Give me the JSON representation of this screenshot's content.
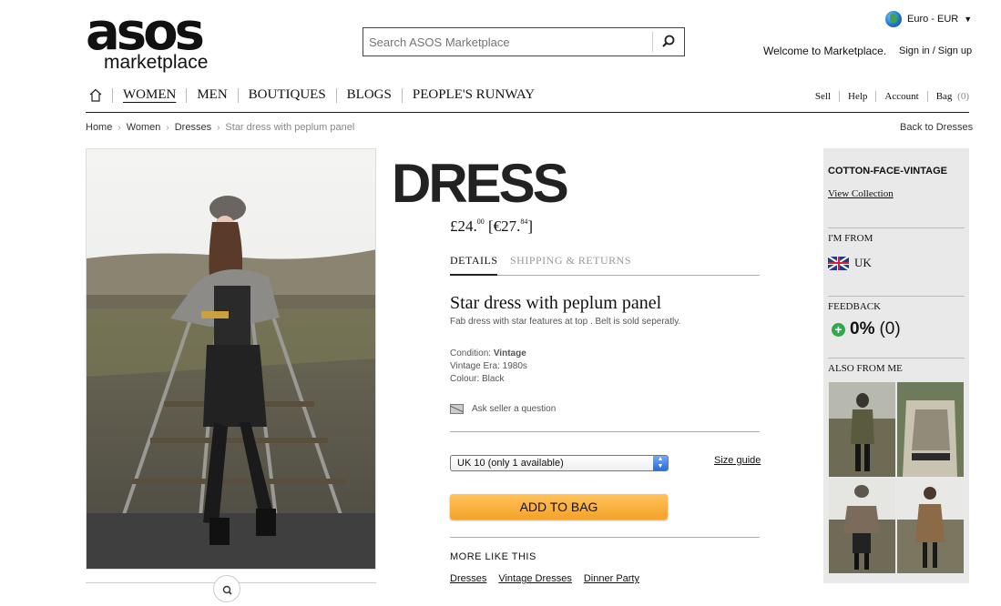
{
  "logo": {
    "main": "asos",
    "sub": "marketplace"
  },
  "search": {
    "placeholder": "Search ASOS Marketplace"
  },
  "currency": {
    "label": "Euro - EUR"
  },
  "welcome": "Welcome to Marketplace.",
  "signin": "Sign in / Sign up",
  "nav": {
    "items": [
      "WOMEN",
      "MEN",
      "BOUTIQUES",
      "BLOGS",
      "PEOPLE'S RUNWAY"
    ],
    "util": [
      "Sell",
      "Help",
      "Account",
      "Bag"
    ],
    "bag_count": "(0)"
  },
  "breadcrumb": [
    "Home",
    "Women",
    "Dresses",
    "Star dress with peplum panel"
  ],
  "back_link": "Back to Dresses",
  "product": {
    "category_title": "DRESS",
    "price_gbp_main": "£24.",
    "price_gbp_pence": "00",
    "price_eur_main": "[€27.",
    "price_eur_cents": "84",
    "price_eur_close": "]",
    "tabs": [
      "DETAILS",
      "SHIPPING & RETURNS"
    ],
    "name": "Star dress with peplum panel",
    "description": "Fab dress with star features at top . Belt is sold seperatly.",
    "condition_label": "Condition:",
    "condition_value": "Vintage",
    "era": "Vintage Era: 1980s",
    "colour": "Colour: Black",
    "ask": "Ask seller a question",
    "size_selected": "UK 10 (only 1 available)",
    "size_guide": "Size guide",
    "add_to_bag": "ADD TO BAG",
    "more_title": "MORE LIKE THIS",
    "more_links": [
      "Dresses",
      "Vintage Dresses",
      "Dinner Party"
    ]
  },
  "seller": {
    "name": "COTTON-FACE-VINTAGE",
    "view_collection": "View Collection",
    "from_label": "I'M FROM",
    "from_value": "UK",
    "feedback_label": "FEEDBACK",
    "feedback_value": "0%",
    "feedback_count": "(0)",
    "also_label": "ALSO FROM ME"
  },
  "colors": {
    "accent_button": "#f5a22a",
    "sidebar_bg": "#e9e9e9",
    "positive": "#2fa84f"
  }
}
